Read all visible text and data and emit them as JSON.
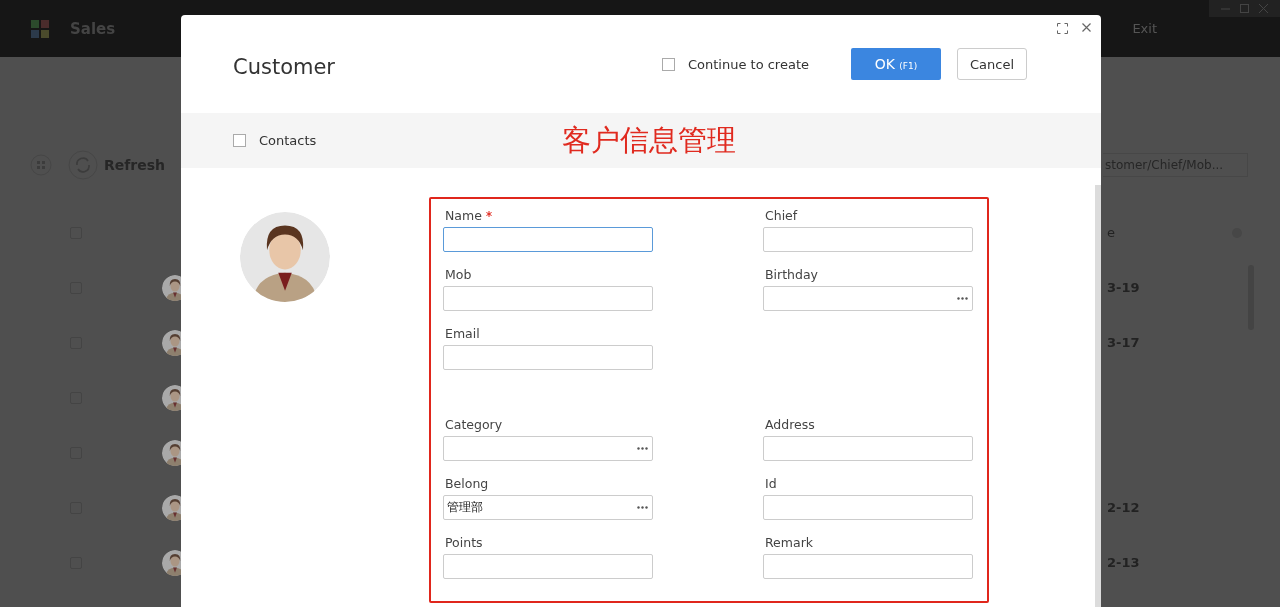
{
  "app": {
    "title": "Sales",
    "exit": "Exit"
  },
  "toolbar": {
    "refresh": "Refresh",
    "search": {
      "placeholder": "stomer/Chief/Mob..."
    }
  },
  "table": {
    "header": {
      "checked": false,
      "column_label": "e"
    },
    "rows": [
      {
        "checked": false,
        "date": "3-19"
      },
      {
        "checked": false,
        "date": "3-17"
      },
      {
        "checked": false
      },
      {
        "checked": false
      },
      {
        "checked": false,
        "date": "2-12"
      },
      {
        "checked": false,
        "date": "2-13"
      }
    ]
  },
  "dialog": {
    "title": "Customer",
    "continue_to_create": {
      "label": "Continue to create",
      "checked": false
    },
    "ok_button": {
      "label": "OK",
      "shortcut": "(F1)"
    },
    "cancel_button": "Cancel",
    "contacts": {
      "label": "Contacts",
      "checked": false
    },
    "banner": "客户信息管理",
    "form": {
      "rows": [
        [
          {
            "label": "Name",
            "required": true,
            "focused": true,
            "kind": "text"
          },
          {
            "label": "Chief",
            "required": false,
            "focused": false,
            "kind": "text"
          }
        ],
        [
          {
            "label": "Mob",
            "required": false,
            "focused": false,
            "kind": "text"
          },
          {
            "label": "Birthday",
            "required": false,
            "focused": false,
            "kind": "picker"
          }
        ],
        [
          {
            "label": "Email",
            "required": false,
            "focused": false,
            "kind": "text"
          }
        ],
        [
          {
            "label": "Category",
            "required": false,
            "focused": false,
            "kind": "picker"
          },
          {
            "label": "Address",
            "required": false,
            "focused": false,
            "kind": "text"
          }
        ],
        [
          {
            "label": "Belong",
            "required": false,
            "focused": false,
            "kind": "picker",
            "value": "管理部"
          },
          {
            "label": "Id",
            "required": false,
            "focused": false,
            "kind": "text"
          }
        ],
        [
          {
            "label": "Points",
            "required": false,
            "focused": false,
            "kind": "text"
          },
          {
            "label": "Remark",
            "required": false,
            "focused": false,
            "kind": "text"
          }
        ]
      ]
    }
  }
}
